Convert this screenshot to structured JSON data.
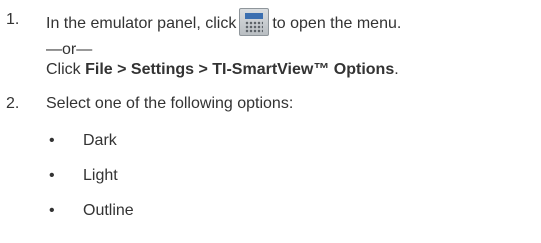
{
  "step1": {
    "number": "1.",
    "text_before_icon": "In the emulator panel, click",
    "icon": "calculator-keypad-icon",
    "text_after_icon": "to open the menu.",
    "separator": "—or—",
    "alt_prefix": "Click ",
    "alt_path": "File > Settings > TI-SmartView™ Options",
    "alt_suffix": "."
  },
  "step2": {
    "number": "2.",
    "text": "Select one of the following options:",
    "bullet_symbol": "•",
    "options": [
      "Dark",
      "Light",
      "Outline"
    ]
  }
}
